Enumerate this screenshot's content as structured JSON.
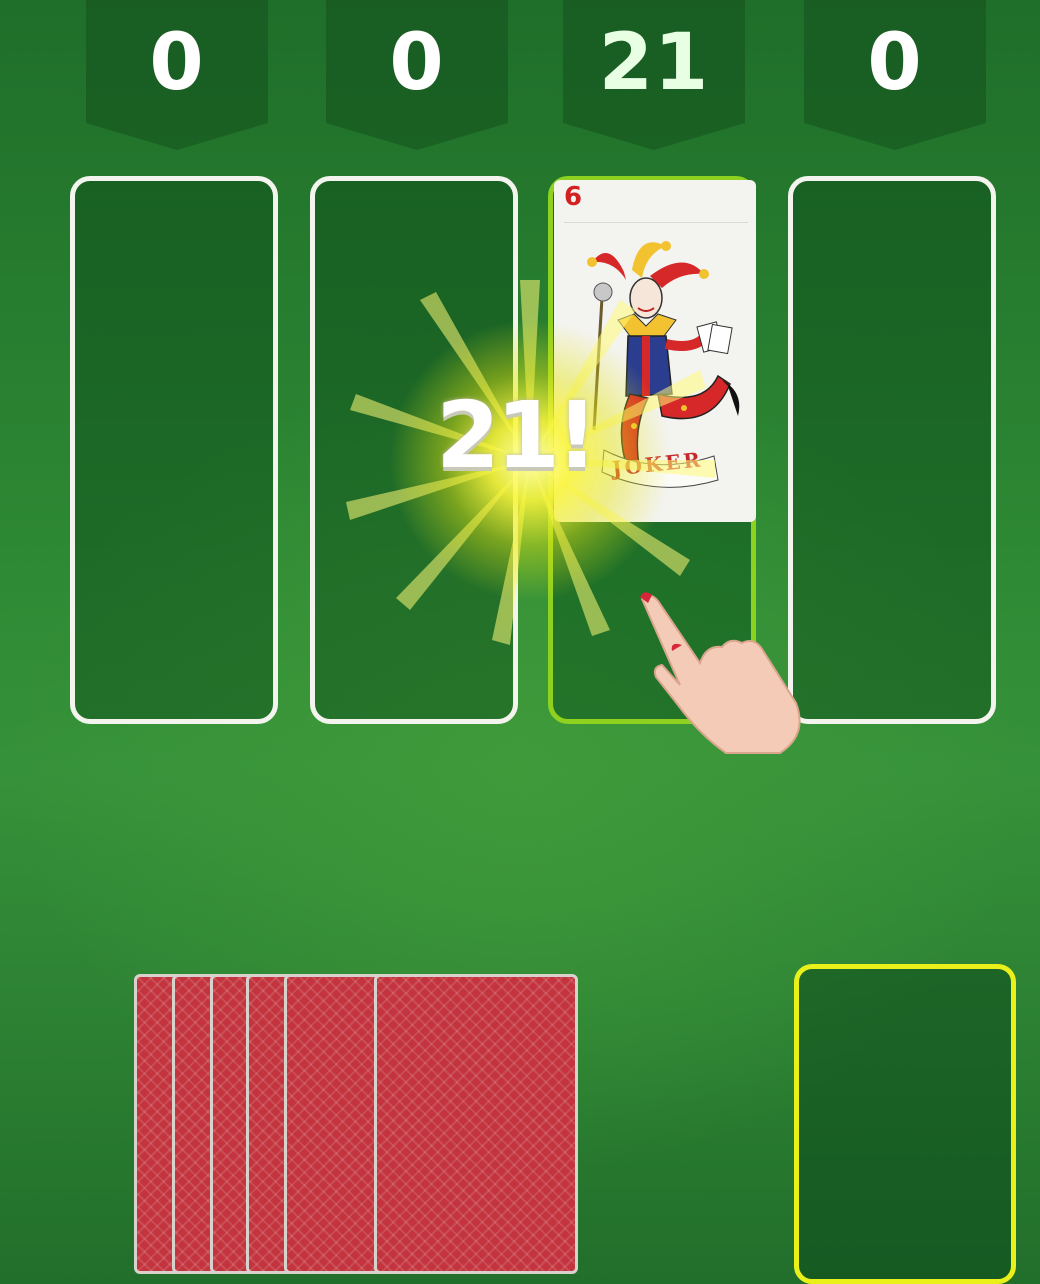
{
  "scores": [
    "0",
    "0",
    "21",
    "0"
  ],
  "active_column": 2,
  "top_card": {
    "rank": "6",
    "face_text": "JOKER",
    "rank_color": "#d32020"
  },
  "combo_text": "21!",
  "deck": {
    "face_down_cards": 6,
    "back_color": "#c3343e"
  },
  "colors": {
    "felt": "#2e8a34",
    "column_border": "#f4f4ee",
    "active_column_border": "#8ed11f",
    "hold_slot_border": "#eaf01a"
  },
  "icons": {
    "tap_hint": "pointing-hand-icon",
    "card_art": "jester-icon"
  }
}
